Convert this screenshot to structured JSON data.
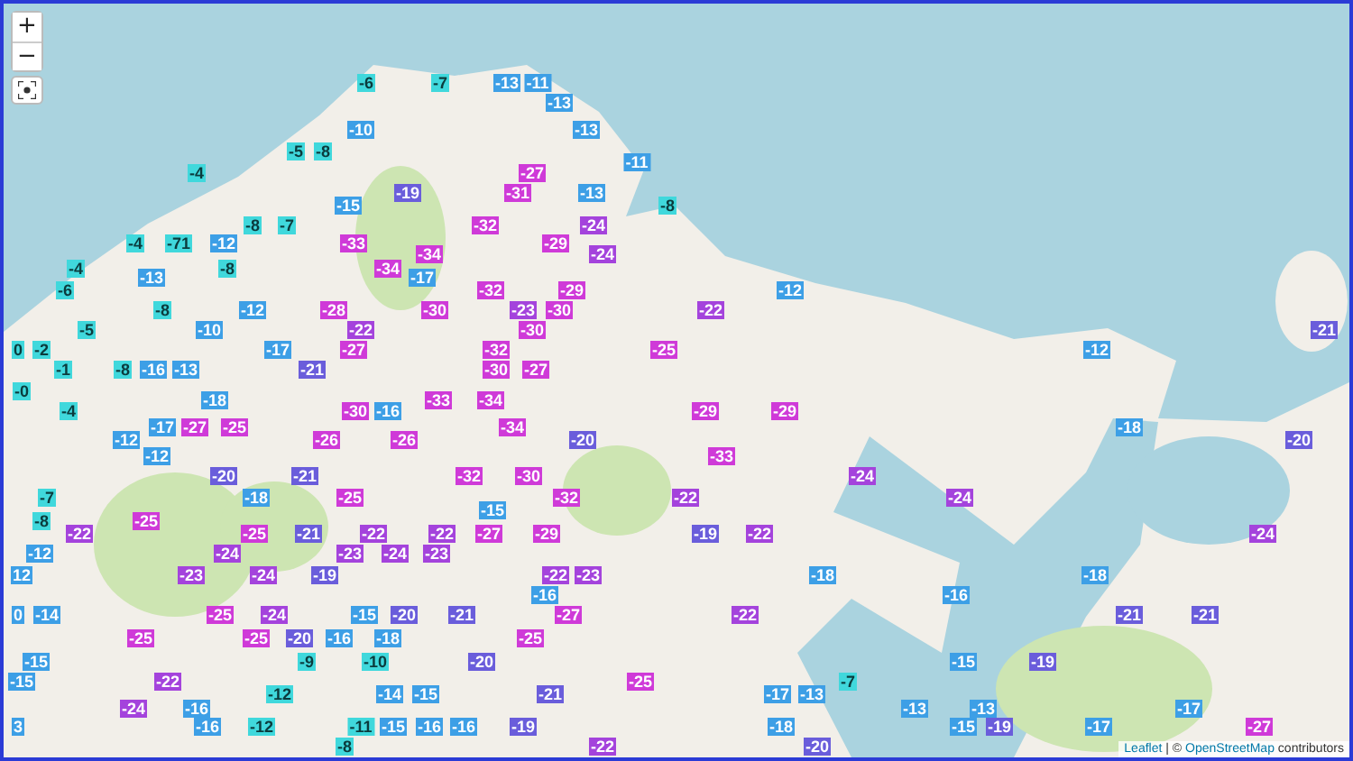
{
  "zoom_controls": [
    {
      "label": "+"
    },
    {
      "label": "−"
    }
  ],
  "markers": [
    {
      "text": "-6",
      "color": "#40d8dc"
    },
    {
      "text": "-7",
      "color": "#40d8dc"
    },
    {
      "text": "-13",
      "color": "#3d9fe6"
    },
    {
      "text": "-11",
      "color": "#3d9fe6"
    },
    {
      "text": "-13",
      "color": "#3d9fe6"
    },
    {
      "text": "-10",
      "color": "#3d9fe6"
    },
    {
      "text": "-13",
      "color": "#3d9fe6"
    },
    {
      "text": "-5",
      "color": "#40d8dc"
    },
    {
      "text": "-8",
      "color": "#40d8dc"
    },
    {
      "text": "-11",
      "color": "#3d9fe6"
    },
    {
      "text": "-4",
      "color": "#40d8dc"
    },
    {
      "text": "-27",
      "color": "#cf3ad8"
    },
    {
      "text": "-19",
      "color": "#6a5ddb"
    },
    {
      "text": "-31",
      "color": "#cf3ad8"
    },
    {
      "text": "-13",
      "color": "#3d9fe6"
    },
    {
      "text": "-15",
      "color": "#3d9fe6"
    },
    {
      "text": "-8",
      "color": "#40d8dc"
    },
    {
      "text": "-8",
      "color": "#40d8dc"
    },
    {
      "text": "-7",
      "color": "#40d8dc"
    },
    {
      "text": "-32",
      "color": "#cf3ad8"
    },
    {
      "text": "-24",
      "color": "#a443dc"
    },
    {
      "text": "-4",
      "color": "#40d8dc"
    },
    {
      "text": "-71",
      "color": "#40d8dc"
    },
    {
      "text": "-12",
      "color": "#3d9fe6"
    },
    {
      "text": "-33",
      "color": "#cf3ad8"
    },
    {
      "text": "-29",
      "color": "#cf3ad8"
    },
    {
      "text": "-34",
      "color": "#cf3ad8"
    },
    {
      "text": "-24",
      "color": "#a443dc"
    },
    {
      "text": "-4",
      "color": "#40d8dc"
    },
    {
      "text": "-8",
      "color": "#40d8dc"
    },
    {
      "text": "-34",
      "color": "#cf3ad8"
    },
    {
      "text": "-13",
      "color": "#3d9fe6"
    },
    {
      "text": "-17",
      "color": "#3d9fe6"
    },
    {
      "text": "-6",
      "color": "#40d8dc"
    },
    {
      "text": "-32",
      "color": "#cf3ad8"
    },
    {
      "text": "-29",
      "color": "#cf3ad8"
    },
    {
      "text": "-12",
      "color": "#3d9fe6"
    },
    {
      "text": "-8",
      "color": "#40d8dc"
    },
    {
      "text": "-12",
      "color": "#3d9fe6"
    },
    {
      "text": "-28",
      "color": "#cf3ad8"
    },
    {
      "text": "-30",
      "color": "#cf3ad8"
    },
    {
      "text": "-23",
      "color": "#a443dc"
    },
    {
      "text": "-30",
      "color": "#cf3ad8"
    },
    {
      "text": "-22",
      "color": "#a443dc"
    },
    {
      "text": "-5",
      "color": "#40d8dc"
    },
    {
      "text": "-10",
      "color": "#3d9fe6"
    },
    {
      "text": "-22",
      "color": "#a443dc"
    },
    {
      "text": "-30",
      "color": "#cf3ad8"
    },
    {
      "text": "-21",
      "color": "#6a5ddb"
    },
    {
      "text": "0",
      "color": "#40d8dc"
    },
    {
      "text": "-2",
      "color": "#40d8dc"
    },
    {
      "text": "-17",
      "color": "#3d9fe6"
    },
    {
      "text": "-27",
      "color": "#cf3ad8"
    },
    {
      "text": "-32",
      "color": "#cf3ad8"
    },
    {
      "text": "-25",
      "color": "#cf3ad8"
    },
    {
      "text": "-12",
      "color": "#3d9fe6"
    },
    {
      "text": "-1",
      "color": "#40d8dc"
    },
    {
      "text": "-8",
      "color": "#40d8dc"
    },
    {
      "text": "-16",
      "color": "#3d9fe6"
    },
    {
      "text": "-13",
      "color": "#3d9fe6"
    },
    {
      "text": "-21",
      "color": "#6a5ddb"
    },
    {
      "text": "-30",
      "color": "#cf3ad8"
    },
    {
      "text": "-27",
      "color": "#cf3ad8"
    },
    {
      "text": "-0",
      "color": "#40d8dc"
    },
    {
      "text": "-18",
      "color": "#3d9fe6"
    },
    {
      "text": "-33",
      "color": "#cf3ad8"
    },
    {
      "text": "-34",
      "color": "#cf3ad8"
    },
    {
      "text": "-4",
      "color": "#40d8dc"
    },
    {
      "text": "-30",
      "color": "#cf3ad8"
    },
    {
      "text": "-16",
      "color": "#3d9fe6"
    },
    {
      "text": "-29",
      "color": "#cf3ad8"
    },
    {
      "text": "-29",
      "color": "#cf3ad8"
    },
    {
      "text": "-17",
      "color": "#3d9fe6"
    },
    {
      "text": "-27",
      "color": "#cf3ad8"
    },
    {
      "text": "-25",
      "color": "#cf3ad8"
    },
    {
      "text": "-34",
      "color": "#cf3ad8"
    },
    {
      "text": "-18",
      "color": "#3d9fe6"
    },
    {
      "text": "-12",
      "color": "#3d9fe6"
    },
    {
      "text": "-26",
      "color": "#cf3ad8"
    },
    {
      "text": "-26",
      "color": "#cf3ad8"
    },
    {
      "text": "-20",
      "color": "#6a5ddb"
    },
    {
      "text": "-20",
      "color": "#6a5ddb"
    },
    {
      "text": "-12",
      "color": "#3d9fe6"
    },
    {
      "text": "-33",
      "color": "#cf3ad8"
    },
    {
      "text": "-20",
      "color": "#6a5ddb"
    },
    {
      "text": "-21",
      "color": "#6a5ddb"
    },
    {
      "text": "-32",
      "color": "#cf3ad8"
    },
    {
      "text": "-30",
      "color": "#cf3ad8"
    },
    {
      "text": "-24",
      "color": "#a443dc"
    },
    {
      "text": "-7",
      "color": "#40d8dc"
    },
    {
      "text": "-18",
      "color": "#3d9fe6"
    },
    {
      "text": "-25",
      "color": "#cf3ad8"
    },
    {
      "text": "-32",
      "color": "#cf3ad8"
    },
    {
      "text": "-22",
      "color": "#a443dc"
    },
    {
      "text": "-24",
      "color": "#a443dc"
    },
    {
      "text": "-15",
      "color": "#3d9fe6"
    },
    {
      "text": "-8",
      "color": "#40d8dc"
    },
    {
      "text": "-25",
      "color": "#cf3ad8"
    },
    {
      "text": "-22",
      "color": "#a443dc"
    },
    {
      "text": "-25",
      "color": "#cf3ad8"
    },
    {
      "text": "-21",
      "color": "#6a5ddb"
    },
    {
      "text": "-22",
      "color": "#a443dc"
    },
    {
      "text": "-22",
      "color": "#a443dc"
    },
    {
      "text": "-27",
      "color": "#cf3ad8"
    },
    {
      "text": "-29",
      "color": "#cf3ad8"
    },
    {
      "text": "-19",
      "color": "#6a5ddb"
    },
    {
      "text": "-22",
      "color": "#a443dc"
    },
    {
      "text": "-24",
      "color": "#a443dc"
    },
    {
      "text": "-12",
      "color": "#3d9fe6"
    },
    {
      "text": "-24",
      "color": "#a443dc"
    },
    {
      "text": "-23",
      "color": "#a443dc"
    },
    {
      "text": "-24",
      "color": "#a443dc"
    },
    {
      "text": "-23",
      "color": "#a443dc"
    },
    {
      "text": "12",
      "color": "#3d9fe6"
    },
    {
      "text": "-23",
      "color": "#a443dc"
    },
    {
      "text": "-24",
      "color": "#a443dc"
    },
    {
      "text": "-19",
      "color": "#6a5ddb"
    },
    {
      "text": "-22",
      "color": "#a443dc"
    },
    {
      "text": "-23",
      "color": "#a443dc"
    },
    {
      "text": "-18",
      "color": "#3d9fe6"
    },
    {
      "text": "-18",
      "color": "#3d9fe6"
    },
    {
      "text": "-16",
      "color": "#3d9fe6"
    },
    {
      "text": "-16",
      "color": "#3d9fe6"
    },
    {
      "text": "0",
      "color": "#3d9fe6"
    },
    {
      "text": "-14",
      "color": "#3d9fe6"
    },
    {
      "text": "-25",
      "color": "#cf3ad8"
    },
    {
      "text": "-24",
      "color": "#a443dc"
    },
    {
      "text": "-15",
      "color": "#3d9fe6"
    },
    {
      "text": "-20",
      "color": "#6a5ddb"
    },
    {
      "text": "-21",
      "color": "#6a5ddb"
    },
    {
      "text": "-27",
      "color": "#cf3ad8"
    },
    {
      "text": "-22",
      "color": "#a443dc"
    },
    {
      "text": "-21",
      "color": "#6a5ddb"
    },
    {
      "text": "-21",
      "color": "#6a5ddb"
    },
    {
      "text": "-25",
      "color": "#cf3ad8"
    },
    {
      "text": "-25",
      "color": "#cf3ad8"
    },
    {
      "text": "-20",
      "color": "#6a5ddb"
    },
    {
      "text": "-16",
      "color": "#3d9fe6"
    },
    {
      "text": "-18",
      "color": "#3d9fe6"
    },
    {
      "text": "-25",
      "color": "#cf3ad8"
    },
    {
      "text": "-15",
      "color": "#3d9fe6"
    },
    {
      "text": "-9",
      "color": "#40d8dc"
    },
    {
      "text": "-10",
      "color": "#40d8dc"
    },
    {
      "text": "-20",
      "color": "#6a5ddb"
    },
    {
      "text": "-15",
      "color": "#3d9fe6"
    },
    {
      "text": "-19",
      "color": "#6a5ddb"
    },
    {
      "text": "-15",
      "color": "#3d9fe6"
    },
    {
      "text": "-22",
      "color": "#a443dc"
    },
    {
      "text": "-25",
      "color": "#cf3ad8"
    },
    {
      "text": "-7",
      "color": "#40d8dc"
    },
    {
      "text": "-12",
      "color": "#40d8dc"
    },
    {
      "text": "-14",
      "color": "#3d9fe6"
    },
    {
      "text": "-15",
      "color": "#3d9fe6"
    },
    {
      "text": "-21",
      "color": "#6a5ddb"
    },
    {
      "text": "-17",
      "color": "#3d9fe6"
    },
    {
      "text": "-13",
      "color": "#3d9fe6"
    },
    {
      "text": "-24",
      "color": "#a443dc"
    },
    {
      "text": "-16",
      "color": "#3d9fe6"
    },
    {
      "text": "-13",
      "color": "#3d9fe6"
    },
    {
      "text": "-13",
      "color": "#3d9fe6"
    },
    {
      "text": "-17",
      "color": "#3d9fe6"
    },
    {
      "text": "3",
      "color": "#3d9fe6"
    },
    {
      "text": "-16",
      "color": "#3d9fe6"
    },
    {
      "text": "-12",
      "color": "#40d8dc"
    },
    {
      "text": "-11",
      "color": "#40d8dc"
    },
    {
      "text": "-15",
      "color": "#3d9fe6"
    },
    {
      "text": "-16",
      "color": "#3d9fe6"
    },
    {
      "text": "-16",
      "color": "#3d9fe6"
    },
    {
      "text": "-19",
      "color": "#6a5ddb"
    },
    {
      "text": "-18",
      "color": "#3d9fe6"
    },
    {
      "text": "-15",
      "color": "#3d9fe6"
    },
    {
      "text": "-19",
      "color": "#6a5ddb"
    },
    {
      "text": "-17",
      "color": "#3d9fe6"
    },
    {
      "text": "-27",
      "color": "#cf3ad8"
    },
    {
      "text": "-8",
      "color": "#40d8dc"
    },
    {
      "text": "-22",
      "color": "#a443dc"
    },
    {
      "text": "-20",
      "color": "#6a5ddb"
    }
  ],
  "attribution": {
    "leaflet_link": "Leaflet",
    "separator": "|",
    "copyright": "©",
    "osm_link": "OpenStreetMap",
    "suffix": "contributors"
  }
}
